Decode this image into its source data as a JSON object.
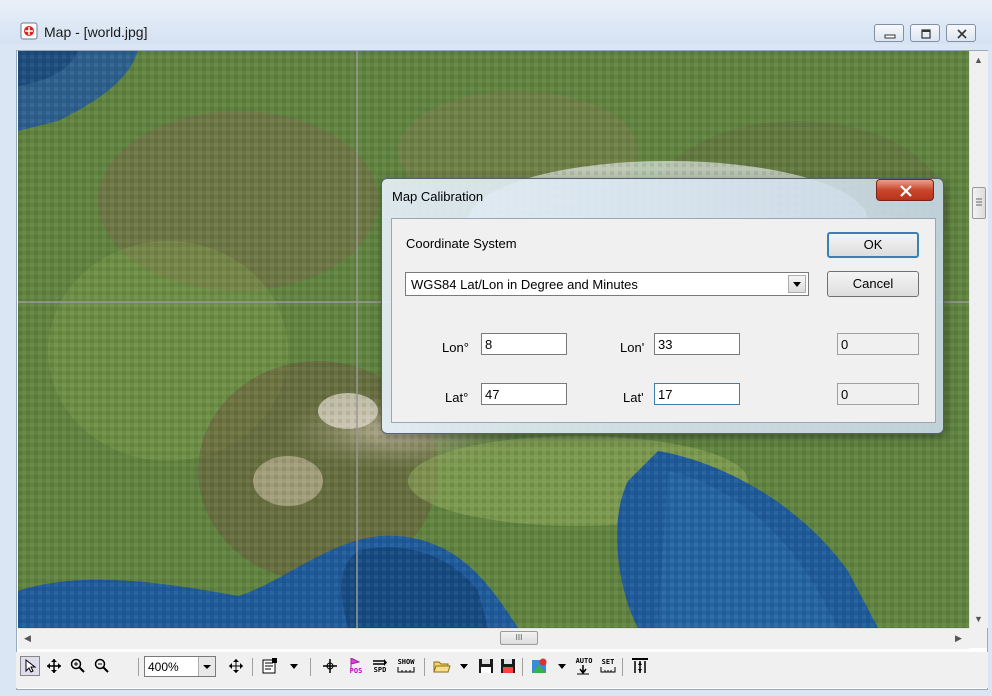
{
  "window": {
    "title": "Map - [world.jpg]"
  },
  "dialog": {
    "title": "Map Calibration",
    "coordinate_system_label": "Coordinate System",
    "coordinate_system_value": "WGS84 Lat/Lon in Degree and Minutes",
    "ok_label": "OK",
    "cancel_label": "Cancel",
    "lon_deg_label": "Lon°",
    "lon_deg_value": "8",
    "lon_min_label": "Lon'",
    "lon_min_value": "33",
    "lon_sec_value": "0",
    "lat_deg_label": "Lat°",
    "lat_deg_value": "47",
    "lat_min_label": "Lat'",
    "lat_min_value": "17",
    "lat_sec_value": "0"
  },
  "toolbar": {
    "zoom_value": "400%",
    "pos_label": "POS",
    "spd_label": "SPD",
    "show_label": "SHOW",
    "auto_label": "AUTO",
    "set_label": "SET",
    "tools": [
      "pointer-icon",
      "pan-icon",
      "zoom-in-icon",
      "zoom-out-icon",
      "fit-width-icon",
      "properties-icon",
      "crosshair-icon",
      "position-icon",
      "speed-icon",
      "show-icon",
      "open-folder-icon",
      "save-icon",
      "save-as-icon",
      "map-pin-icon",
      "auto-icon",
      "set-icon",
      "track-icon"
    ]
  },
  "colors": {
    "accent": "#3c7fb1",
    "close_button": "#c9482d",
    "sea": "#1f5a9a"
  }
}
